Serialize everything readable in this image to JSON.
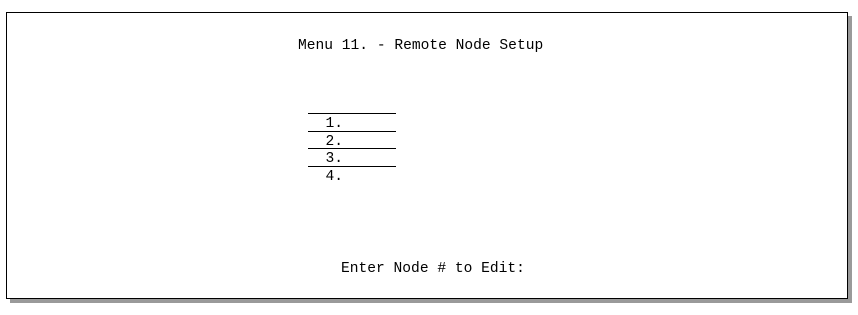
{
  "menu": {
    "title": "Menu 11. - Remote Node Setup",
    "nodes": [
      {
        "label": "1."
      },
      {
        "label": "2."
      },
      {
        "label": "3."
      },
      {
        "label": "4."
      }
    ],
    "prompt": "Enter Node # to Edit:",
    "input_value": ""
  }
}
